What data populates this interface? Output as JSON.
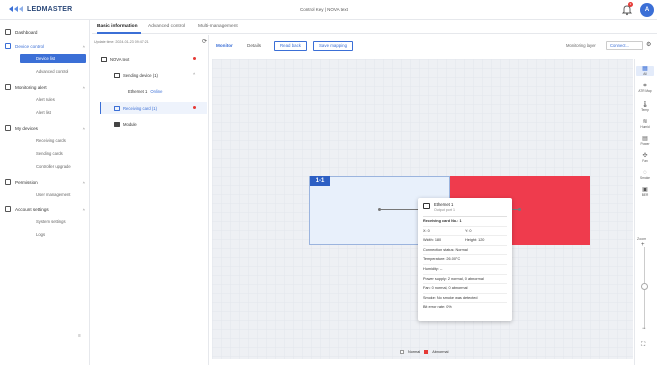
{
  "app": {
    "logo_text": "LEDMASTER",
    "center_title": "Control Key | NOVA text",
    "badge_count": "3",
    "avatar_letter": "A"
  },
  "sidebar": {
    "items": [
      {
        "label": "Dashboard"
      },
      {
        "label": "Device control"
      },
      {
        "label": "Monitoring alert"
      },
      {
        "label": "My devices"
      },
      {
        "label": "Permission"
      },
      {
        "label": "Account settings"
      }
    ],
    "subitems": {
      "device_control": [
        "Device list",
        "Advanced control"
      ],
      "monitoring": [
        "Alert rules",
        "Alert list"
      ],
      "my_devices": [
        "Receiving cards",
        "Sending cards",
        "Controller upgrade"
      ],
      "permission": [
        "User management"
      ],
      "account": [
        "System settings",
        "Logs"
      ]
    },
    "collapse_glyph": "≡"
  },
  "tabs": [
    "Basic information",
    "Advanced control",
    "Multi-management"
  ],
  "tree": {
    "update_time": "Update time: 2024-01-23 09:47:21",
    "root": "NOVA text",
    "sending": "Sending device (1)",
    "ethernet": "Ethernet 1",
    "ethernet_status": "Online",
    "receiving": "Receiving card (1)",
    "module": "Module"
  },
  "toolbar": {
    "monitor": "Monitor",
    "details": "Details",
    "read_back": "Read back",
    "save_mapping": "Save mapping",
    "monitoring_layer_label": "Monitoring layer",
    "monitoring_layer_value": "Connect..."
  },
  "canvas": {
    "card_tag": "1-1"
  },
  "tooltip": {
    "port": "Ethernet 1",
    "port_sub": "Output port 1",
    "title": "Receiving card No.: 1",
    "x": "X: 0",
    "y": "Y: 0",
    "width": "Width: 180",
    "height": "Height: 120",
    "connection": "Connection status: Normal",
    "temperature": "Temperature: 26.00°C",
    "humidity": "Humidity: --",
    "power": "Power supply: 2 normal, 0 abnormal",
    "fan": "Fan: 0 normal, 0 abnormal",
    "smoke": "Smoke: No smoke was detected",
    "bit_error": "Bit error rate: 0%"
  },
  "right_tools": [
    {
      "label": "All",
      "glyph": "▦"
    },
    {
      "label": "ATR Map",
      "glyph": "⌗"
    },
    {
      "label": "Temp",
      "glyph": "🌡"
    },
    {
      "label": "Humid",
      "glyph": "≋"
    },
    {
      "label": "Power",
      "glyph": "▤"
    },
    {
      "label": "Fan",
      "glyph": "✣"
    },
    {
      "label": "Smoke",
      "glyph": "◌"
    },
    {
      "label": "BER",
      "glyph": "▣"
    }
  ],
  "zoom": {
    "label": "Zoom",
    "level": 0.48
  },
  "legend": {
    "normal": "Normal",
    "abnormal": "Abnormal"
  },
  "colors": {
    "accent": "#3b6fd6",
    "abnormal": "#ef3b4d",
    "dark_blue": "#2d5fc4"
  }
}
